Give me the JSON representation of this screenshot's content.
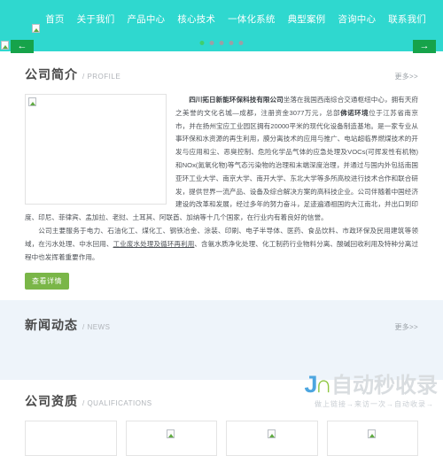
{
  "header": {
    "logo_alt": "logo-image",
    "nav": [
      {
        "label": "首页"
      },
      {
        "label": "关于我们"
      },
      {
        "label": "产品中心"
      },
      {
        "label": "核心技术"
      },
      {
        "label": "一体化系统"
      },
      {
        "label": "典型案例"
      },
      {
        "label": "咨询中心"
      },
      {
        "label": "联系我们"
      }
    ],
    "bg_color": "#2fd8cf"
  },
  "banner": {
    "prev_label": "←",
    "next_label": "→",
    "arrow_color": "#16a34a",
    "dots": [
      {
        "active": true
      },
      {
        "active": false
      },
      {
        "active": false
      },
      {
        "active": false
      },
      {
        "active": false
      }
    ]
  },
  "profile": {
    "title_cn": "公司简介",
    "title_en": "/ PROFILE",
    "more": "更多>>",
    "photo_alt": "company-photo",
    "para_lead": "四川拓日新能环保科技有限公司",
    "para_1": "坐落在我国西南综合交通枢纽中心，拥有天府之美誉的文化名城—成都，注册资金3077万元，总部",
    "para_brand": "佛诺环境",
    "para_2": "位于江苏省南京市，并在扬州宝应工业园区拥有20000平米的现代化设备制造基地。是一家专业从事环保和水资源的再生利用，膜分离技术的应用与推广、电站超临界燃煤技术的开发与应用和尘、恶臭控制、危险化学品气体的应急处理及VOCs(可挥发性有机物)和NOx(氮氧化物)等气态污染物的治理和末端深度治理，并通过与国内外包括南国亚环工业大学、南京大学、南开大学、东北大学等多所高校进行技术合作和联合研发，提供世界一流产品、设备及综合解决方案的高科技企业。公司伴随着中国经济建设的改革和发展，经过多年的努力奋斗，足迹遍通祖国的大江南北，并出口到印度、印尼、菲律宾、孟加拉、老挝、土耳其、阿联酋、加纳等十几个国家，在行业内有着良好的信誉。",
    "para_3": "公司主要服务于电力、石油化工、煤化工、钢铁冶金、涂装、印刷、电子半导体、医药、食品饮料、市政环保及民用建筑等领域，在污水处理、中水回用、",
    "para_3_link": "工业废水处理及循环再利用",
    "para_3_tail": "、含氨水质净化处理、化工制药行业物料分离、酸碱回收利用及特种分离过程中也发挥着重要作用。",
    "detail_button": "查看详情"
  },
  "news": {
    "title_cn": "新闻动态",
    "title_en": "/ NEWS",
    "more": "更多>>",
    "bg_color": "#eef4fa"
  },
  "qualifications": {
    "title_cn": "公司资质",
    "title_en": "/ QUALIFICATIONS",
    "cards": [
      {
        "alt": ""
      },
      {
        "alt": "qualification-image"
      },
      {
        "alt": "qualification-image"
      },
      {
        "alt": "qualification-image"
      }
    ]
  },
  "watermark": {
    "mark_j": "J",
    "mark_n": "∩",
    "text": "自动秒收录",
    "subtitle": "做上链接→来访一次→自动收录→"
  }
}
